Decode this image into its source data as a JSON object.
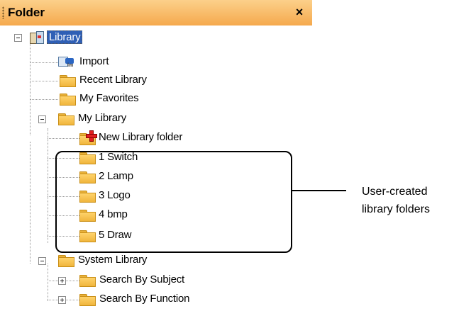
{
  "panel": {
    "title": "Folder",
    "close_glyph": "×"
  },
  "tree": {
    "root": {
      "label": "Library",
      "icon": "library-icon"
    },
    "items": [
      {
        "label": "Import",
        "icon": "import-icon"
      },
      {
        "label": "Recent Library",
        "icon": "folder-icon"
      },
      {
        "label": "My Favorites",
        "icon": "folder-icon"
      },
      {
        "label": "My Library",
        "icon": "folder-icon",
        "expanded": true
      },
      {
        "label": "New Library folder",
        "icon": "new-folder-icon"
      },
      {
        "label": "1 Switch",
        "icon": "folder-icon"
      },
      {
        "label": "2 Lamp",
        "icon": "folder-icon"
      },
      {
        "label": "3 Logo",
        "icon": "folder-icon"
      },
      {
        "label": "4 bmp",
        "icon": "folder-icon"
      },
      {
        "label": "5 Draw",
        "icon": "folder-icon"
      },
      {
        "label": "System Library",
        "icon": "folder-icon",
        "expanded": true
      },
      {
        "label": "Search By Subject",
        "icon": "folder-icon",
        "expanded": false
      },
      {
        "label": "Search By Function",
        "icon": "folder-icon",
        "expanded": false
      }
    ]
  },
  "annotation": {
    "line1": "User-created",
    "line2": "library folders"
  },
  "colors": {
    "titlebar": "#f5a94d",
    "selection": "#2f5fb5",
    "folder": "#f0b53c"
  }
}
